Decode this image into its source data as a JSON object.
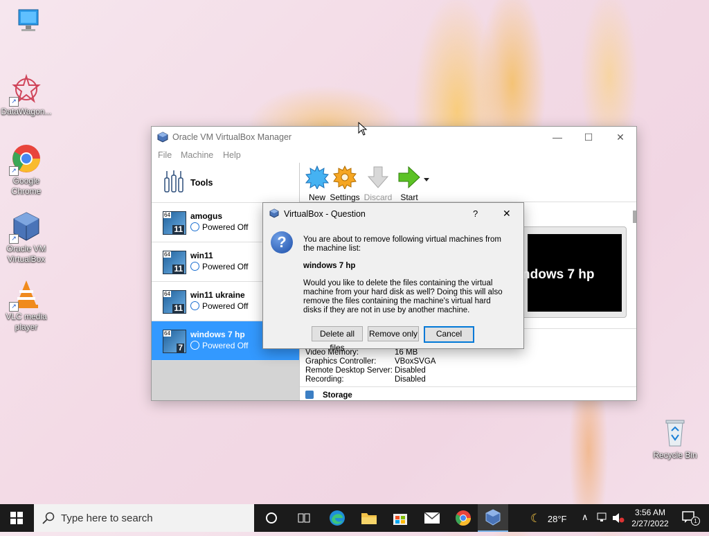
{
  "desktop": {
    "icons": [
      {
        "label": "",
        "icon": "this-pc-icon"
      },
      {
        "label": "DataWagon...",
        "icon": "datawagon-icon"
      },
      {
        "label": "Google Chrome",
        "icon": "chrome-icon"
      },
      {
        "label": "Oracle VM VirtualBox",
        "icon": "virtualbox-icon"
      },
      {
        "label": "VLC media player",
        "icon": "vlc-icon"
      },
      {
        "label": "Recycle Bin",
        "icon": "recycle-bin-icon"
      }
    ]
  },
  "window": {
    "title": "Oracle VM VirtualBox Manager",
    "controls": {
      "minimize": "—",
      "maximize": "☐",
      "close": "✕"
    },
    "menu": [
      "File",
      "Machine",
      "Help"
    ],
    "tools_label": "Tools",
    "vms": [
      {
        "name": "amogus",
        "state": "Powered Off",
        "badge": "11",
        "selected": false
      },
      {
        "name": "win11",
        "state": "Powered Off",
        "badge": "11",
        "selected": false
      },
      {
        "name": "win11 ukraine",
        "state": "Powered Off",
        "badge": "11",
        "selected": false
      },
      {
        "name": "windows 7 hp",
        "state": "Powered Off",
        "badge": "7",
        "selected": true
      }
    ],
    "os_badge_bits": "64",
    "toolbar": {
      "new": "New",
      "settings": "Settings",
      "discard": "Discard",
      "start": "Start"
    },
    "preview_text": "ndows 7 hp",
    "details": {
      "rows": [
        {
          "label": "Video Memory:",
          "value": "16 MB"
        },
        {
          "label": "Graphics Controller:",
          "value": "VBoxSVGA"
        },
        {
          "label": "Remote Desktop Server:",
          "value": "Disabled"
        },
        {
          "label": "Recording:",
          "value": "Disabled"
        }
      ],
      "storage_header": "Storage"
    }
  },
  "dialog": {
    "title": "VirtualBox - Question",
    "help": "?",
    "close": "✕",
    "line1": "You are about to remove following virtual machines from the machine list:",
    "vm_name": "windows 7 hp",
    "line2": "Would you like to delete the files containing the virtual machine from your hard disk as well? Doing this will also remove the files containing the machine's virtual hard disks if they are not in use by another machine.",
    "buttons": {
      "delete_all": "Delete all files",
      "remove_only": "Remove only",
      "cancel": "Cancel"
    }
  },
  "taskbar": {
    "search_placeholder": "Type here to search",
    "weather": "28°F",
    "time": "3:56 AM",
    "date": "2/27/2022",
    "notification_count": "1"
  }
}
